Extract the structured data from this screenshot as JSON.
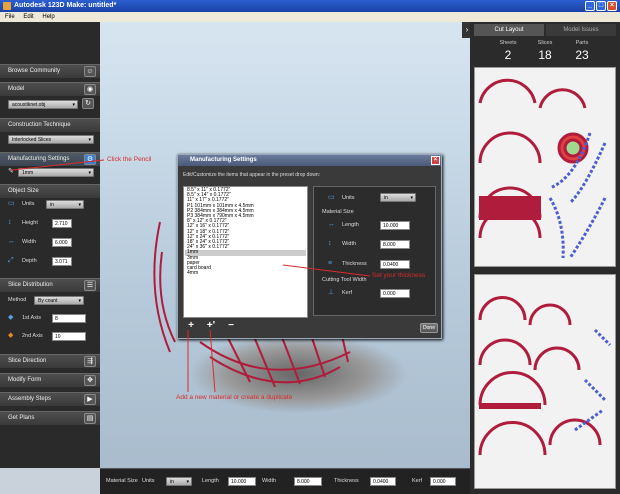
{
  "window": {
    "title": "Autodesk 123D Make: untitled*"
  },
  "menu": [
    "File",
    "Edit",
    "Help"
  ],
  "left_panel": {
    "browse_community": "Browse Community",
    "model": "Model",
    "model_file": "acoustiknet.obj",
    "construction_technique": "Construction Technique",
    "technique_value": "Interlocked Slices",
    "manufacturing_settings": "Manufacturing Settings",
    "material_value": "1mm",
    "object_size": "Object Size",
    "units_label": "Units",
    "units_value": "in",
    "height_label": "Height",
    "height_value": "2.710",
    "width_label": "Width",
    "width_value": "6.000",
    "depth_label": "Depth",
    "depth_value": "3.071",
    "slice_distribution": "Slice Distribution",
    "method_label": "Method",
    "method_value": "By count",
    "axis1_label": "1st Axis",
    "axis1_value": "8",
    "axis2_label": "2nd Axis",
    "axis2_value": "10",
    "slice_direction": "Slice Direction",
    "modify_form": "Modify Form",
    "assembly_steps": "Assembly Steps",
    "get_plans": "Get Plans"
  },
  "right_panel": {
    "tab_cut_layout": "Cut Layout",
    "tab_model_issues": "Model Issues",
    "sheets_label": "Sheets",
    "sheets_value": "2",
    "slices_label": "Slices",
    "slices_value": "18",
    "parts_label": "Parts",
    "parts_value": "23"
  },
  "dialog": {
    "title": "Manufacturing Settings",
    "instruction": "Edit/Customize the items that appear in the preset drop down:",
    "presets": [
      "8.5\" x 11\" x 0.1772\"",
      "8.5\" x 14\" x 0.1772\"",
      "11\" x 17\" x 0.1772\"",
      "P1 101mm x 101mm x 4.5mm",
      "P2 384mm x 384mm x 4.5mm",
      "P3 384mm x 790mm x 4.5mm",
      "8\" x 12\" x 0.1772\"",
      "12\" x 16\" x 0.1772\"",
      "12\" x 18\" x 0.1772\"",
      "12\" x 24\" x 0.1772\"",
      "18\" x 24\" x 0.1772\"",
      "24\" x 36\" x 0.1772\"",
      "1mm",
      "3mm",
      "paper",
      "card board",
      "4mm"
    ],
    "selected_index": 12,
    "units_label": "Units",
    "units_value": "in",
    "material_size_label": "Material Size",
    "length_label": "Length",
    "length_value": "10.000",
    "width_label": "Width",
    "width_value": "8.000",
    "thickness_label": "Thickness",
    "thickness_value": "0.0400",
    "cutting_tool_label": "Cutting Tool Width",
    "kerf_label": "Kerf",
    "kerf_value": "0.000",
    "add_label": "+",
    "duplicate_label": "+'",
    "remove_label": "−",
    "done_label": "Done"
  },
  "bottom_bar": {
    "material_size": "Material Size",
    "units_label": "Units",
    "units_value": "in",
    "length_label": "Length",
    "length_value": "10.000",
    "width_label": "Width",
    "width_value": "8.000",
    "thickness_label": "Thickness",
    "thickness_value": "0.0400",
    "kerf_label": "Kerf",
    "kerf_value": "0.000"
  },
  "annotations": {
    "pencil": "Click the Pencil",
    "thickness": "Set your thickness",
    "add": "Add a new material or create a duplicate"
  },
  "colors": {
    "annotation": "#d92b2b",
    "cut_red": "#b01c3c",
    "cut_blue": "#4a5fd0"
  }
}
